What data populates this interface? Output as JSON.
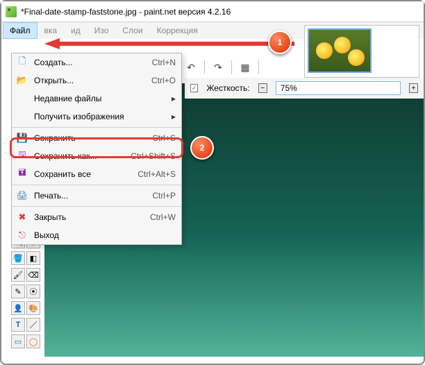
{
  "titlebar": {
    "text": "*Final-date-stamp-faststone.jpg - paint.net версия 4.2.16"
  },
  "menubar": {
    "items": [
      {
        "label": "Файл"
      },
      {
        "label": "вка"
      },
      {
        "label": "ид"
      },
      {
        "label": "Изо"
      },
      {
        "label": "Слои"
      },
      {
        "label": "Коррекция"
      }
    ]
  },
  "toolbar2": {
    "label_hardness": "Жесткость:",
    "value": "75%"
  },
  "dropdown": {
    "items": [
      {
        "icon": "new",
        "label": "Создать...",
        "shortcut": "Ctrl+N"
      },
      {
        "icon": "open",
        "label": "Открыть...",
        "shortcut": "Ctrl+O"
      },
      {
        "icon": "",
        "label": "Недавние файлы",
        "shortcut": "",
        "sub": true
      },
      {
        "icon": "",
        "label": "Получить изображения",
        "shortcut": "",
        "sub": true
      },
      {
        "sep": true
      },
      {
        "icon": "save",
        "label": "Сохранить",
        "shortcut": "Ctrl+S"
      },
      {
        "icon": "saveas",
        "label": "Сохранить как...",
        "shortcut": "Ctrl+Shift+S"
      },
      {
        "icon": "saveall",
        "label": "Сохранить все",
        "shortcut": "Ctrl+Alt+S"
      },
      {
        "sep": true
      },
      {
        "icon": "print",
        "label": "Печать...",
        "shortcut": "Ctrl+P"
      },
      {
        "sep": true
      },
      {
        "icon": "close",
        "label": "Закрыть",
        "shortcut": "Ctrl+W"
      },
      {
        "icon": "exit",
        "label": "Выход",
        "shortcut": ""
      }
    ]
  },
  "callouts": {
    "c1": "1",
    "c2": "2"
  }
}
